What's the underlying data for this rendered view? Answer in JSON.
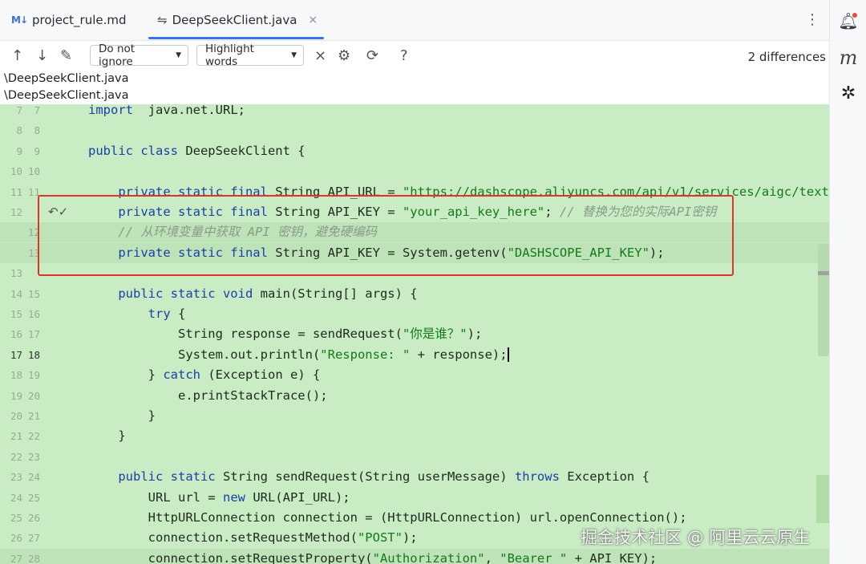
{
  "tabs": [
    {
      "icon": "markdown-icon",
      "icon_text": "M↓",
      "label": "project_rule.md"
    },
    {
      "icon": "diff-icon",
      "label": "DeepSeekClient.java",
      "close": "×"
    }
  ],
  "toolbar": {
    "ignore_dropdown": "Do not ignore",
    "highlight_dropdown": "Highlight words",
    "differences": "2 differences"
  },
  "paths": {
    "left": "\\DeepSeekClient.java",
    "right": "\\DeepSeekClient.java"
  },
  "code_lines": [
    {
      "l": "7",
      "r": "7",
      "segs": [
        [
          "kw",
          "import"
        ],
        [
          "",
          "  java.net.URL;"
        ]
      ]
    },
    {
      "l": "8",
      "r": "8",
      "segs": []
    },
    {
      "l": "9",
      "r": "9",
      "segs": [
        [
          "kw",
          "public class"
        ],
        [
          "",
          " DeepSeekClient {"
        ]
      ]
    },
    {
      "l": "10",
      "r": "10",
      "segs": []
    },
    {
      "l": "11",
      "r": "11",
      "segs": [
        [
          "",
          "    "
        ],
        [
          "kw",
          "private static final"
        ],
        [
          "",
          " String API_URL = "
        ],
        [
          "str",
          "\"https://dashscope.aliyuncs.com/api/v1/services/aigc/text-"
        ]
      ]
    },
    {
      "l": "12",
      "r": "",
      "segs": [
        [
          "",
          "    "
        ],
        [
          "kw",
          "private static final"
        ],
        [
          "",
          " String API_KEY = "
        ],
        [
          "str",
          "\"your_api_key_here\""
        ],
        [
          "",
          "; "
        ],
        [
          "cmt",
          "// 替换为您的实际API密钥"
        ]
      ]
    },
    {
      "l": "",
      "r": "12",
      "segs": [
        [
          "",
          "    "
        ],
        [
          "cmt",
          "// 从环境变量中获取 API 密钥，避免硬编码"
        ]
      ]
    },
    {
      "l": "",
      "r": "13",
      "segs": [
        [
          "",
          "    "
        ],
        [
          "kw",
          "private static final"
        ],
        [
          "",
          " String API_KEY = System.getenv("
        ],
        [
          "str",
          "\"DASHSCOPE_API_KEY\""
        ],
        [
          "",
          ");"
        ]
      ]
    },
    {
      "l": "13",
      "r": "",
      "segs": []
    },
    {
      "l": "14",
      "r": "15",
      "segs": [
        [
          "",
          "    "
        ],
        [
          "kw",
          "public static void"
        ],
        [
          "",
          " main(String[] args) {"
        ]
      ]
    },
    {
      "l": "15",
      "r": "16",
      "segs": [
        [
          "",
          "        "
        ],
        [
          "kw",
          "try"
        ],
        [
          "",
          " {"
        ]
      ]
    },
    {
      "l": "16",
      "r": "17",
      "segs": [
        [
          "",
          "            String response = sendRequest("
        ],
        [
          "str",
          "\"你是谁？\""
        ],
        [
          "",
          ");"
        ]
      ]
    },
    {
      "l": "17",
      "r": "18",
      "segs": [
        [
          "",
          "            System.out.println("
        ],
        [
          "str",
          "\"Response: \""
        ],
        [
          "",
          " + response);"
        ]
      ]
    },
    {
      "l": "18",
      "r": "19",
      "segs": [
        [
          "",
          "        } "
        ],
        [
          "kw",
          "catch"
        ],
        [
          "",
          " (Exception e) {"
        ]
      ]
    },
    {
      "l": "19",
      "r": "20",
      "segs": [
        [
          "",
          "            e.printStackTrace();"
        ]
      ]
    },
    {
      "l": "20",
      "r": "21",
      "segs": [
        [
          "",
          "        }"
        ]
      ]
    },
    {
      "l": "21",
      "r": "22",
      "segs": [
        [
          "",
          "    }"
        ]
      ]
    },
    {
      "l": "22",
      "r": "23",
      "segs": []
    },
    {
      "l": "23",
      "r": "24",
      "segs": [
        [
          "",
          "    "
        ],
        [
          "kw",
          "public static"
        ],
        [
          "",
          " String sendRequest(String userMessage) "
        ],
        [
          "kw",
          "throws"
        ],
        [
          "",
          " Exception {"
        ]
      ]
    },
    {
      "l": "24",
      "r": "25",
      "segs": [
        [
          "",
          "        URL url = "
        ],
        [
          "kw",
          "new"
        ],
        [
          "",
          " URL(API_URL);"
        ]
      ]
    },
    {
      "l": "25",
      "r": "26",
      "segs": [
        [
          "",
          "        HttpURLConnection connection = (HttpURLConnection) url.openConnection();"
        ]
      ]
    },
    {
      "l": "26",
      "r": "27",
      "segs": [
        [
          "",
          "        connection.setRequestMethod("
        ],
        [
          "str",
          "\"POST\""
        ],
        [
          "",
          ");"
        ]
      ]
    },
    {
      "l": "27",
      "r": "28",
      "segs": [
        [
          "",
          "        connection.setRequestProperty("
        ],
        [
          "str",
          "\"Authorization\""
        ],
        [
          "",
          ", "
        ],
        [
          "str",
          "\"Bearer \""
        ],
        [
          "",
          " + API_KEY);"
        ]
      ]
    }
  ],
  "watermark": "掘金技术社区 @ 阿里云云原生",
  "colors": {
    "added_bg": "#c9ecc4",
    "highlight_border": "#e0332a",
    "keyword": "#1b3ea8",
    "string": "#127a1a",
    "accent": "#3574f0"
  }
}
